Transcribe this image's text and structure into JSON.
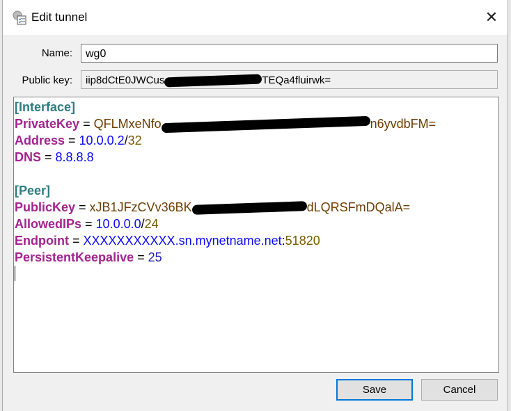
{
  "window": {
    "title": "Edit tunnel",
    "close_icon": "close-icon",
    "app_icon": "settings-checklist-icon"
  },
  "form": {
    "name_label": "Name:",
    "name_value": "wg0",
    "pubkey_label": "Public key:",
    "pubkey_start": "iip8dCtE0JWCus",
    "pubkey_end": "TEQa4fluirwk="
  },
  "config": {
    "interface_header": "[Interface]",
    "private_key": {
      "key": "PrivateKey",
      "start": "QFLMxeNfo",
      "end": "n6yvdbFM="
    },
    "address": {
      "key": "Address",
      "ip": "10.0.0.2",
      "slash": "/",
      "mask": "32"
    },
    "dns": {
      "key": "DNS",
      "value": "8.8.8.8"
    },
    "peer_header": "[Peer]",
    "public_key": {
      "key": "PublicKey",
      "start": "xJB1JFzCVv36BK",
      "end": "dLQRSFmDQalA="
    },
    "allowed_ips": {
      "key": "AllowedIPs",
      "ip": "10.0.0.0",
      "slash": "/",
      "mask": "24"
    },
    "endpoint": {
      "key": "Endpoint",
      "host": "XXXXXXXXXXX.sn.mynetname.net",
      "colon": ":",
      "port": "51820"
    },
    "keepalive": {
      "key": "PersistentKeepalive",
      "value": "25"
    },
    "equals": " = "
  },
  "buttons": {
    "save": "Save",
    "cancel": "Cancel"
  }
}
